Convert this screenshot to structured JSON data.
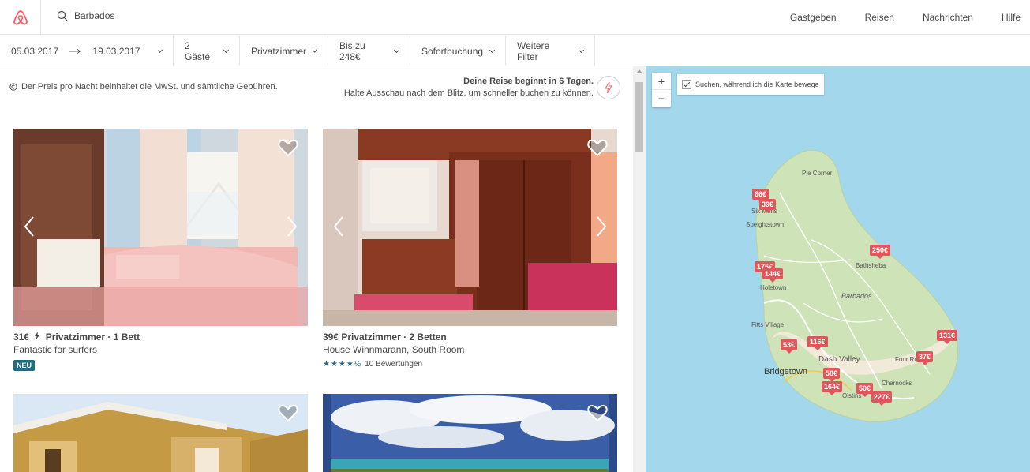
{
  "header": {
    "logo": "airbnb-logo",
    "search_value": "Barbados",
    "nav": [
      "Gastgeben",
      "Reisen",
      "Nachrichten",
      "Hilfe"
    ]
  },
  "filters": {
    "checkin": "05.03.2017",
    "checkout": "19.03.2017",
    "guests": "2 Gäste",
    "room_type": "Privatzimmer",
    "price": "Bis zu 248€",
    "instant": "Sofortbuchung",
    "more": "Weitere Filter"
  },
  "notes": {
    "price_note": "Der Preis pro Nacht beinhaltet die MwSt. und sämtliche Gebühren.",
    "trip_title": "Deine Reise beginnt in 6 Tagen.",
    "trip_sub": "Halte Ausschau nach dem Blitz, um schneller buchen zu können."
  },
  "listings": [
    {
      "price": "31€",
      "type": "Privatzimmer · 1 Bett",
      "name": "Fantastic for surfers",
      "badge": "NEU"
    },
    {
      "price": "39€",
      "type": "Privatzimmer · 2 Betten",
      "name": "House Winnmarann, South Room",
      "reviews": "10 Bewertungen",
      "rating": 4.5
    }
  ],
  "map": {
    "checkbox_label": "Suchen, während ich die Karte bewege",
    "zoom_in": "+",
    "zoom_out": "−",
    "places": [
      "Pie Corner",
      "Six Mens",
      "Speightstown",
      "Bathsheba",
      "Holetown",
      "Barbados",
      "Fitts Village",
      "Dash Valley",
      "Bridgetown",
      "Four Roads",
      "Charnocks",
      "Oistins"
    ],
    "pins": [
      "66€",
      "39€",
      "250€",
      "175€",
      "144€",
      "131€",
      "53€",
      "116€",
      "37€",
      "58€",
      "164€",
      "50€",
      "227€"
    ],
    "colors": {
      "water": "#a3d7ec",
      "land": "#cfe3b8",
      "pin": "#e0565b"
    }
  }
}
